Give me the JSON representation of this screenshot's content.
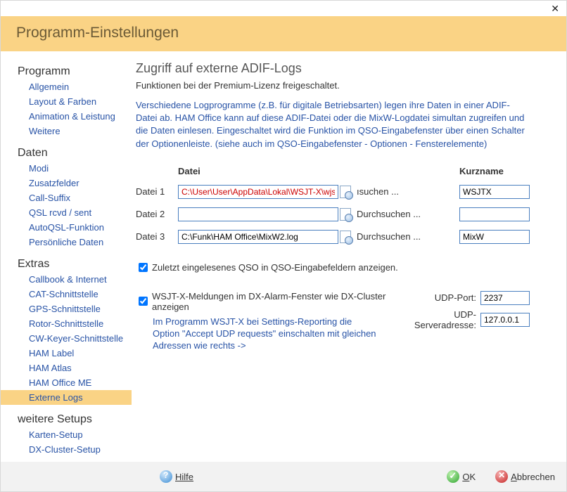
{
  "window": {
    "title": "Programm-Einstellungen"
  },
  "sidebar": {
    "sections": [
      {
        "title": "Programm",
        "items": [
          "Allgemein",
          "Layout & Farben",
          "Animation & Leistung",
          "Weitere"
        ]
      },
      {
        "title": "Daten",
        "items": [
          "Modi",
          "Zusatzfelder",
          "Call-Suffix",
          "QSL rcvd / sent",
          "AutoQSL-Funktion",
          "Persönliche Daten"
        ]
      },
      {
        "title": "Extras",
        "items": [
          "Callbook & Internet",
          "CAT-Schnittstelle",
          "GPS-Schnittstelle",
          "Rotor-Schnittstelle",
          "CW-Keyer-Schnittstelle",
          "HAM Label",
          "HAM Atlas",
          "HAM Office ME",
          "Externe Logs"
        ],
        "active_index": 8
      },
      {
        "title": "weitere Setups",
        "items": [
          "Karten-Setup",
          "DX-Cluster-Setup"
        ]
      }
    ]
  },
  "page": {
    "heading": "Zugriff auf externe ADIF-Logs",
    "subtitle": "Funktionen bei der Premium-Lizenz freigeschaltet.",
    "blurb": "Verschiedene Logprogramme (z.B. für digitale Betriebsarten) legen ihre Daten in einer ADIF-Datei ab. HAM Office kann auf diese ADIF-Datei oder die MixW-Logdatei simultan zugreifen und die Daten einlesen. Eingeschaltet wird die Funktion im QSO-Eingabefenster über einen Schalter der Optionenleiste. (siehe auch im QSO-Eingabefenster - Optionen - Fensterelemente)",
    "col_datei": "Datei",
    "col_kurz": "Kurzname",
    "browse_label": "Durchsuchen ...",
    "browse_label_trunc": "ısuchen ...",
    "rows": [
      {
        "label": "Datei 1",
        "path": "C:\\User\\User\\AppData\\Lokal\\WSJT-X\\wjst log.adi",
        "short": "WSJTX",
        "red": true,
        "trunc_browse": true
      },
      {
        "label": "Datei 2",
        "path": "",
        "short": "",
        "red": false,
        "trunc_browse": false
      },
      {
        "label": "Datei 3",
        "path": "C:\\Funk\\HAM Office\\MixW2.log",
        "short": "MixW",
        "red": false,
        "trunc_browse": false
      }
    ],
    "check_last_qso": "Zuletzt eingelesenes QSO in QSO-Eingabefeldern anzeigen.",
    "wsjt_check": "WSJT-X-Meldungen im DX-Alarm-Fenster wie DX-Cluster anzeigen",
    "wsjt_note": "Im Programm WSJT-X bei Settings-Reporting die Option \"Accept UDP requests\" einschalten mit gleichen Adressen wie rechts ->",
    "udp_port_label": "UDP-Port:",
    "udp_port_value": "2237",
    "udp_server_label": "UDP-Serveradresse:",
    "udp_server_value": "127.0.0.1"
  },
  "footer": {
    "help": "Hilfe",
    "ok": "OK",
    "cancel": "Abbrechen"
  }
}
